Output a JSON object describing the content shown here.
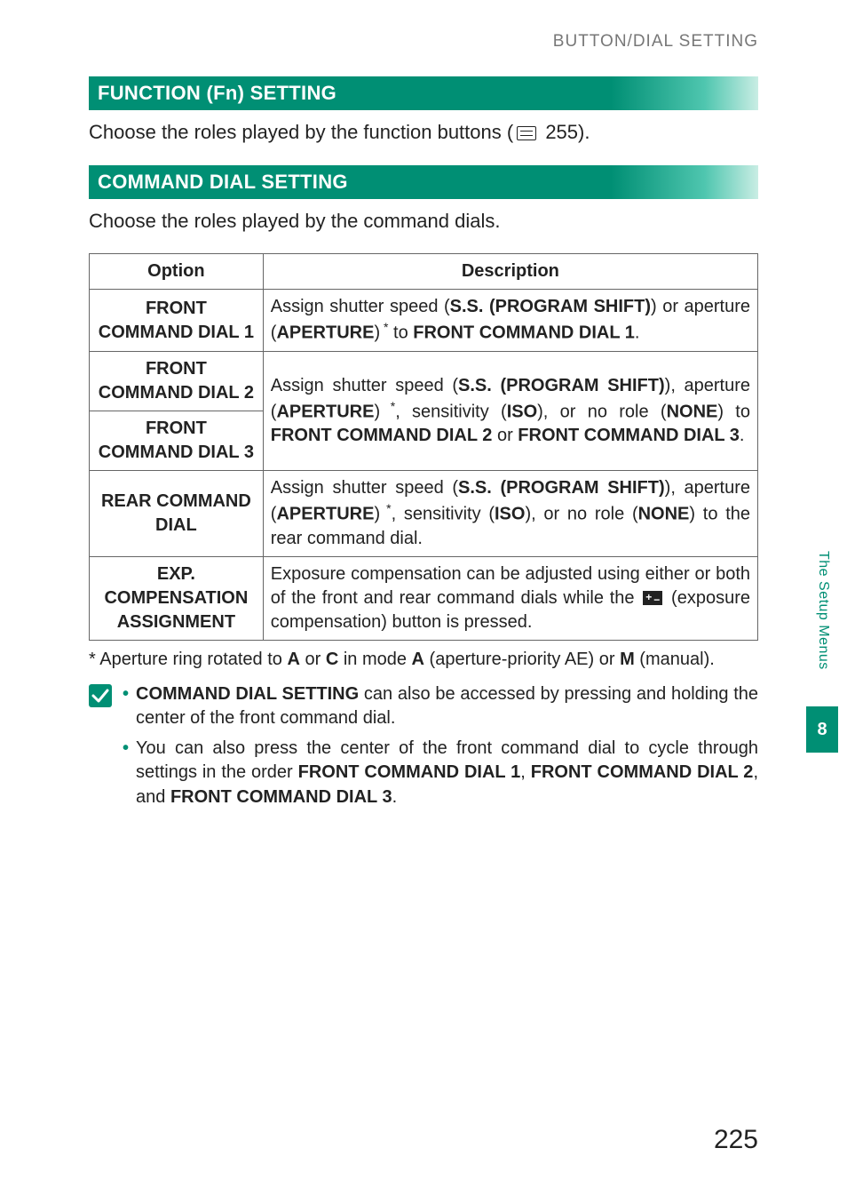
{
  "header": {
    "breadcrumb": "BUTTON/DIAL SETTING"
  },
  "section1": {
    "title": "FUNCTION (Fn) SETTING",
    "intro_pre": "Choose the roles played by the function buttons (",
    "intro_post": " 255)."
  },
  "section2": {
    "title": "COMMAND DIAL SETTING",
    "intro": "Choose the roles played by the command dials."
  },
  "table": {
    "head_option": "Option",
    "head_desc": "Description",
    "r1_opt": "FRONT COMMAND DIAL 1",
    "r1_desc_a": "Assign shutter speed (",
    "r1_desc_b": "S.S. (PROGRAM SHIFT)",
    "r1_desc_c": ") or aperture (",
    "r1_desc_d": "APERTURE",
    "r1_desc_e": ")",
    "r1_desc_f": " to ",
    "r1_desc_g": "FRONT COMMAND DIAL 1",
    "r1_desc_h": ".",
    "r2_opt": "FRONT COMMAND DIAL 2",
    "r3_opt": "FRONT COMMAND DIAL 3",
    "r23_desc_a": "Assign shutter speed (",
    "r23_desc_b": "S.S. (PROGRAM SHIFT)",
    "r23_desc_c": "), aperture (",
    "r23_desc_d": "APERTURE",
    "r23_desc_e": ")",
    "r23_desc_f": ", sensitivity (",
    "r23_desc_g": "ISO",
    "r23_desc_h": "), or no role (",
    "r23_desc_i": "NONE",
    "r23_desc_j": ") to ",
    "r23_desc_k": "FRONT COMMAND DIAL 2",
    "r23_desc_l": " or ",
    "r23_desc_m": "FRONT COMMAND DIAL 3",
    "r23_desc_n": ".",
    "r4_opt": "REAR COMMAND DIAL",
    "r4_desc_a": "Assign shutter speed (",
    "r4_desc_b": "S.S. (PROGRAM SHIFT)",
    "r4_desc_c": "), aperture (",
    "r4_desc_d": "APERTURE",
    "r4_desc_e": ")",
    "r4_desc_f": ", sensitivity (",
    "r4_desc_g": "ISO",
    "r4_desc_h": "), or no role (",
    "r4_desc_i": "NONE",
    "r4_desc_j": ") to the rear command dial.",
    "r5_opt": "EXP. COMPENSATION ASSIGNMENT",
    "r5_desc_a": "Exposure compensation can be adjusted using either or both of the front and rear command dials while the ",
    "r5_desc_b": " (exposure compensation) button is pressed."
  },
  "footnote": {
    "pre": "* Aperture ring rotated to ",
    "a": "A",
    "mid1": " or ",
    "c": "C",
    "mid2": " in mode ",
    "a2": "A",
    "mid3": " (aperture-priority AE) or ",
    "m": "M",
    "post": " (manual)."
  },
  "tips": {
    "b1_a": "COMMAND DIAL SETTING",
    "b1_b": " can also be accessed by pressing and holding the center of the front command dial.",
    "b2_a": "You can also press the center of the front command dial to cycle through settings in the order ",
    "b2_b": "FRONT COMMAND DIAL 1",
    "b2_c": ", ",
    "b2_d": "FRONT COMMAND DIAL 2",
    "b2_e": ", and ",
    "b2_f": "FRONT COMMAND DIAL 3",
    "b2_g": "."
  },
  "side": {
    "label": "The Setup Menus",
    "chapter": "8"
  },
  "page_number": "225"
}
